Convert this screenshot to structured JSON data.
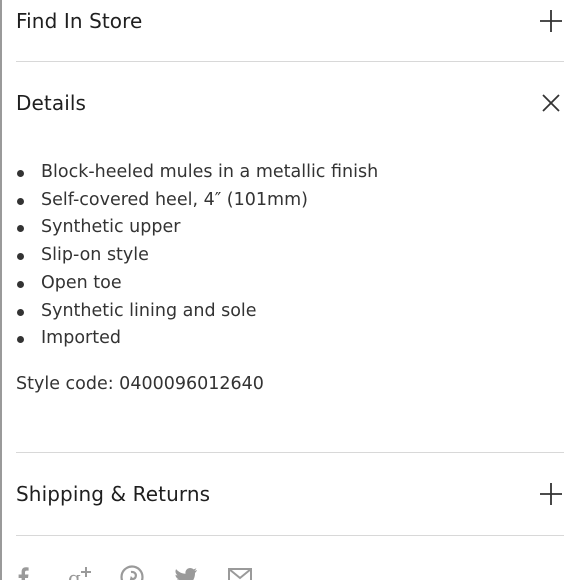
{
  "sections": {
    "find_in_store": {
      "title": "Find In Store",
      "toggle_icon": "plus-icon"
    },
    "details": {
      "title": "Details",
      "toggle_icon": "close-icon",
      "bullets": [
        "Block-heeled mules in a metallic finish",
        "Self-covered heel, 4″ (101mm)",
        "Synthetic upper",
        "Slip-on style",
        "Open toe",
        "Synthetic lining and sole",
        "Imported"
      ],
      "style_code": "Style code: 0400096012640"
    },
    "shipping_returns": {
      "title": "Shipping & Returns",
      "toggle_icon": "plus-icon"
    }
  },
  "share": {
    "icons": [
      "facebook-icon",
      "google-plus-icon",
      "pinterest-icon",
      "twitter-icon",
      "email-icon"
    ],
    "color": "#9a9a9a"
  },
  "colors": {
    "text": "#222222",
    "divider": "#d8d8d8"
  }
}
